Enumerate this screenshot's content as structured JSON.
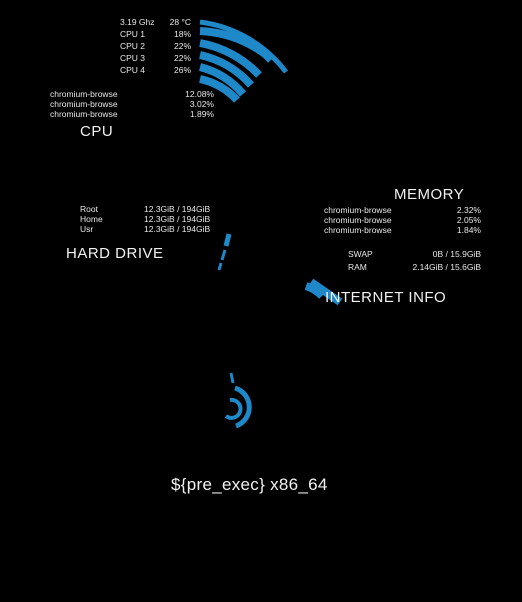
{
  "colors": {
    "accent": "#1e88c8",
    "background": "#000000",
    "text": "#e8e8e8"
  },
  "cpu": {
    "title": "CPU",
    "freq": "3.19 Ghz",
    "temp": "28 °C",
    "cores": [
      {
        "label": "CPU 1",
        "value": "18%",
        "fraction": 0.18
      },
      {
        "label": "CPU 2",
        "value": "22%",
        "fraction": 0.22
      },
      {
        "label": "CPU 3",
        "value": "22%",
        "fraction": 0.22
      },
      {
        "label": "CPU 4",
        "value": "26%",
        "fraction": 0.26
      }
    ],
    "processes": [
      {
        "name": "chromium-browse",
        "value": "12.08%"
      },
      {
        "name": "chromium-browse",
        "value": "3.02%"
      },
      {
        "name": "chromium-browse",
        "value": "1.89%"
      }
    ]
  },
  "hard_drive": {
    "title": "HARD DRIVE",
    "mounts": [
      {
        "label": "Root",
        "value": "12.3GiB / 194GiB"
      },
      {
        "label": "Home",
        "value": "12.3GiB / 194GiB"
      },
      {
        "label": "Usr",
        "value": "12.3GiB / 194GiB"
      }
    ]
  },
  "memory": {
    "title": "MEMORY",
    "processes": [
      {
        "name": "chromium-browse",
        "value": "2.32%"
      },
      {
        "name": "chromium-browse",
        "value": "2.05%"
      },
      {
        "name": "chromium-browse",
        "value": "1.84%"
      }
    ],
    "swap": {
      "label": "SWAP",
      "value": "0B  /  15.9GiB"
    },
    "ram": {
      "label": "RAM",
      "value": "2.14GiB / 15.6GiB"
    }
  },
  "internet": {
    "title": "INTERNET INFO"
  },
  "footer": {
    "text": "${pre_exec} x86_64"
  }
}
